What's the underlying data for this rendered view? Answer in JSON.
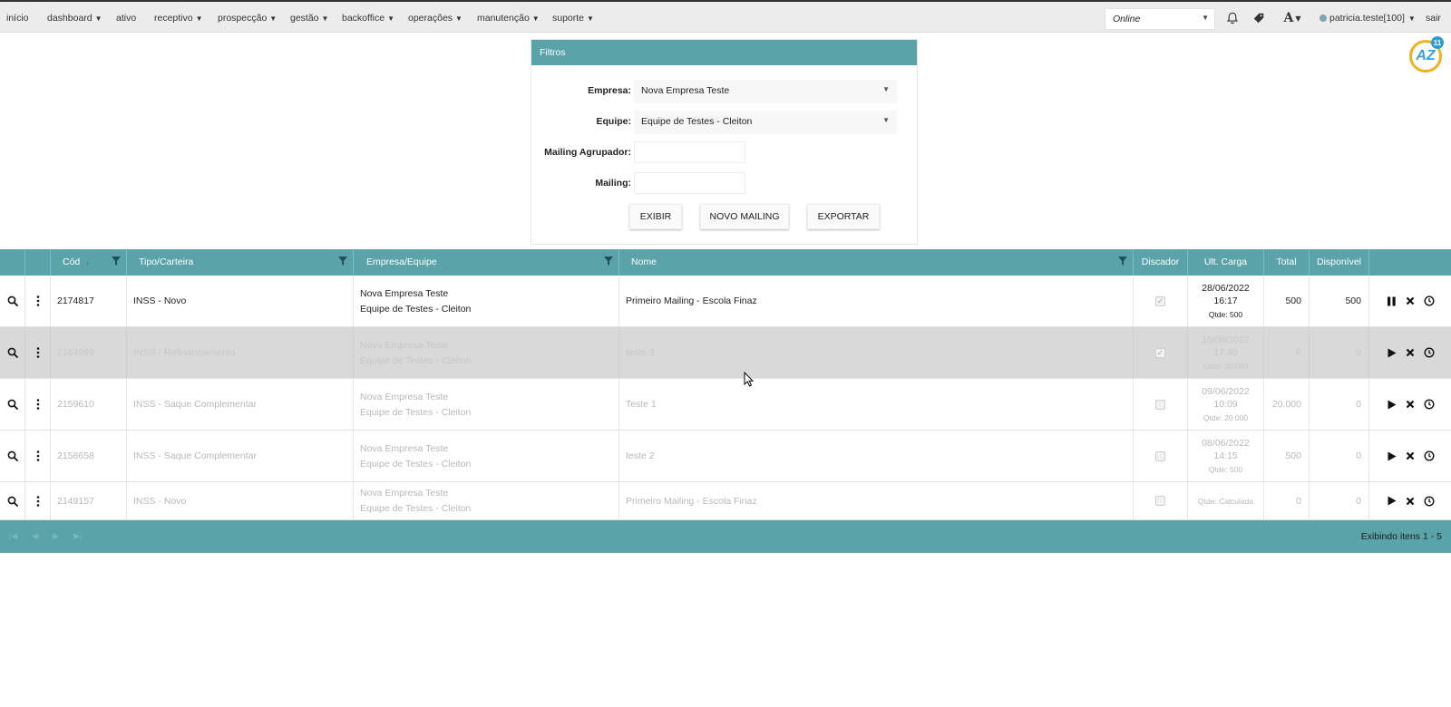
{
  "nav": {
    "items": [
      {
        "label": "início",
        "caret": false
      },
      {
        "label": "dashboard",
        "caret": true
      },
      {
        "label": "ativo",
        "caret": false
      },
      {
        "label": "receptivo",
        "caret": true
      },
      {
        "label": "prospecção",
        "caret": true
      },
      {
        "label": "gestão",
        "caret": true
      },
      {
        "label": "backoffice",
        "caret": true
      },
      {
        "label": "operações",
        "caret": true
      },
      {
        "label": "manutenção",
        "caret": true
      },
      {
        "label": "suporte",
        "caret": true
      }
    ],
    "status": "Online",
    "user": "patricia.teste[100]",
    "logout": "sair",
    "az_logo": "AZ",
    "az_count": "11"
  },
  "filters": {
    "title": "Filtros",
    "empresa_label": "Empresa:",
    "empresa_value": "Nova Empresa Teste",
    "equipe_label": "Equipe:",
    "equipe_value": "Equipe de Testes - Cleiton",
    "mailing_agrupador_label": "Mailing Agrupador:",
    "mailing_agrupador_value": "",
    "mailing_label": "Mailing:",
    "mailing_value": "",
    "buttons": {
      "exibir": "EXIBIR",
      "novo": "NOVO MAILING",
      "exportar": "EXPORTAR"
    }
  },
  "grid": {
    "columns": {
      "cod": "Cód",
      "tipo": "Tipo/Carteira",
      "empresa": "Empresa/Equipe",
      "nome": "Nome",
      "discador": "Discador",
      "ult_carga": "Ult. Carga",
      "total": "Total",
      "disponivel": "Disponível"
    },
    "rows": [
      {
        "cod": "2174817",
        "tipo": "INSS - Novo",
        "empresa": "Nova Empresa Teste",
        "equipe": "Equipe de Testes - Cleiton",
        "nome": "Primeiro Mailing - Escola Finaz",
        "discador": true,
        "data": "28/06/2022",
        "hora": "16:17",
        "qtde": "Qtde: 500",
        "total": "500",
        "disponivel": "500",
        "state": "running"
      },
      {
        "cod": "2164899",
        "tipo": "INSS - Refinanciamento",
        "empresa": "Nova Empresa Teste",
        "equipe": "Equipe de Testes - Cleiton",
        "nome": "teste 3",
        "discador": true,
        "data": "15/06/2022",
        "hora": "17:40",
        "qtde": "Qtde: 20.000",
        "total": "0",
        "disponivel": "0",
        "state": "paused"
      },
      {
        "cod": "2159610",
        "tipo": "INSS - Saque Complementar",
        "empresa": "Nova Empresa Teste",
        "equipe": "Equipe de Testes - Cleiton",
        "nome": "Teste 1",
        "discador": false,
        "data": "09/06/2022",
        "hora": "10:09",
        "qtde": "Qtde: 20.000",
        "total": "20.000",
        "disponivel": "0",
        "state": "paused"
      },
      {
        "cod": "2158658",
        "tipo": "INSS - Saque Complementar",
        "empresa": "Nova Empresa Teste",
        "equipe": "Equipe de Testes - Cleiton",
        "nome": "teste 2",
        "discador": false,
        "data": "08/06/2022",
        "hora": "14:15",
        "qtde": "Qtde: 500",
        "total": "500",
        "disponivel": "0",
        "state": "paused"
      },
      {
        "cod": "2149157",
        "tipo": "INSS - Novo",
        "empresa": "Nova Empresa Teste",
        "equipe": "Equipe de Testes - Cleiton",
        "nome": "Primeiro Mailing - Escola Finaz",
        "discador": false,
        "data": "",
        "hora": "",
        "qtde": "Qtde: Calculada",
        "total": "0",
        "disponivel": "0",
        "state": "paused"
      }
    ],
    "paging_info": "Exibindo itens 1 - 5"
  },
  "colors": {
    "accent": "#5aa3a8",
    "highlight_row": "#d9d9d9",
    "badge": "#f2b01e"
  }
}
